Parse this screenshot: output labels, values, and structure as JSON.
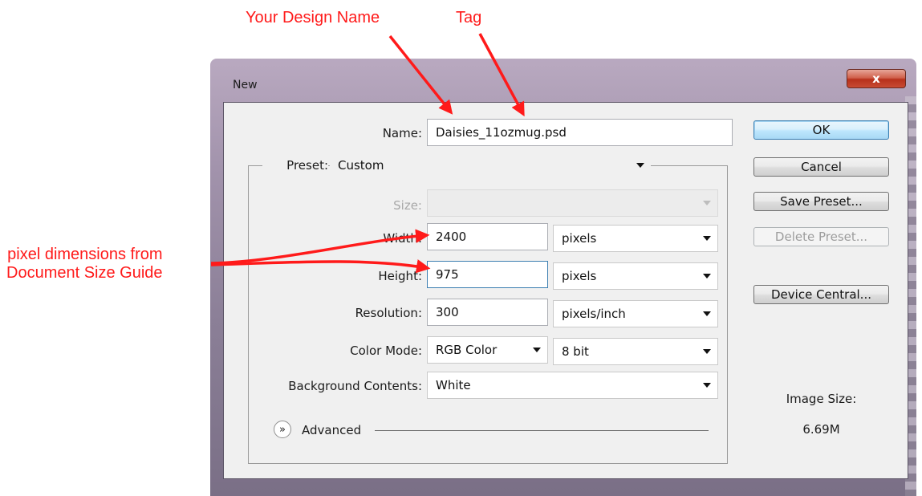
{
  "annotations": {
    "design_name": "Your Design Name",
    "tag": "Tag",
    "pixel_line1": "pixel dimensions from",
    "pixel_line2": "Document Size Guide"
  },
  "dialog": {
    "title": "New",
    "close_label": "x",
    "name_label": "Name:",
    "name_value": "Daisies_11ozmug.psd",
    "preset_label": "Preset:",
    "preset_value": "Custom",
    "size_label": "Size:",
    "size_value": "",
    "width_label": "Width:",
    "width_value": "2400",
    "width_unit": "pixels",
    "height_label": "Height:",
    "height_value": "975",
    "height_unit": "pixels",
    "resolution_label": "Resolution:",
    "resolution_value": "300",
    "resolution_unit": "pixels/inch",
    "color_mode_label": "Color Mode:",
    "color_mode_value": "RGB Color",
    "bit_depth_value": "8 bit",
    "background_label": "Background Contents:",
    "background_value": "White",
    "advanced_label": "Advanced",
    "buttons": {
      "ok": "OK",
      "cancel": "Cancel",
      "save_preset": "Save Preset...",
      "delete_preset": "Delete Preset...",
      "device_central": "Device Central..."
    },
    "image_size_label": "Image Size:",
    "image_size_value": "6.69M"
  },
  "colors": {
    "annotation": "#ff1a1a",
    "focus": "#3c7fb1"
  }
}
